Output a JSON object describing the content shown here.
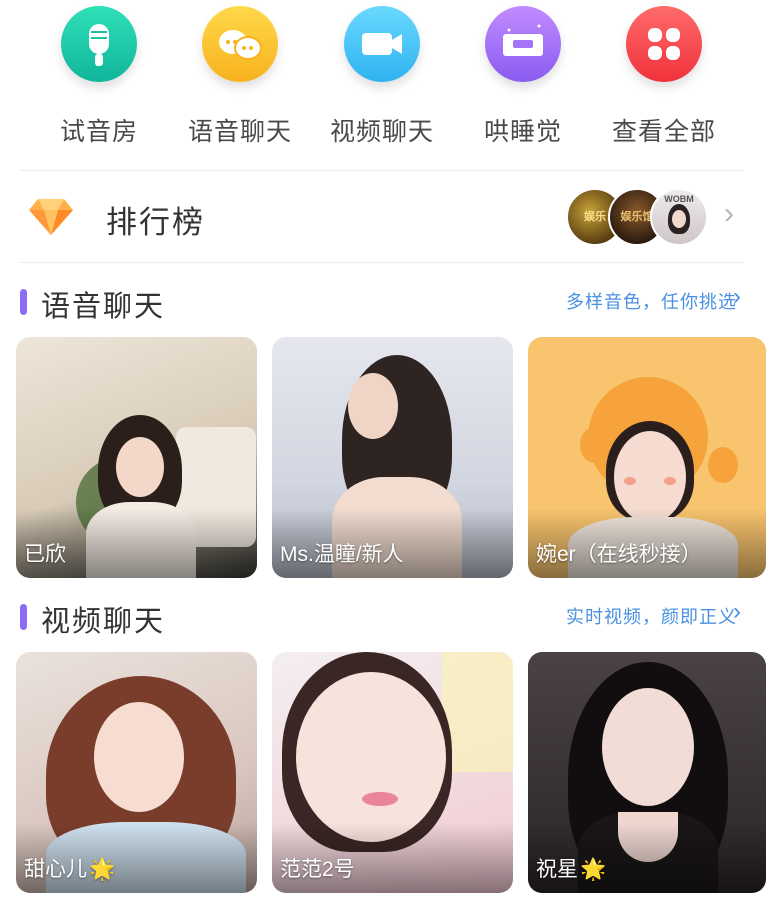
{
  "nav": {
    "items": [
      {
        "label": "试音房",
        "icon": "microphone-icon",
        "color_top": "#2fe0b8",
        "color_bottom": "#11b59a"
      },
      {
        "label": "语音聊天",
        "icon": "chat-bubbles-icon",
        "color_top": "#ffd84a",
        "color_bottom": "#f7b21d"
      },
      {
        "label": "视频聊天",
        "icon": "video-camera-icon",
        "color_top": "#6ad9ff",
        "color_bottom": "#2fb2f0"
      },
      {
        "label": "哄睡觉",
        "icon": "sleep-icon",
        "color_top": "#c18bff",
        "color_bottom": "#8a5cf0"
      },
      {
        "label": "查看全部",
        "icon": "grid-all-icon",
        "color_top": "#ff6b6b",
        "color_bottom": "#f0323c"
      }
    ]
  },
  "ranking": {
    "title": "排行榜",
    "icon": "diamond-icon",
    "avatar_texts": [
      "娱乐",
      "娱乐馆",
      "WOBM"
    ]
  },
  "voice_section": {
    "title": "语音聊天",
    "link": "多样音色，任你挑选",
    "cards": [
      {
        "name": "已欣",
        "bg": "#e9e2d6"
      },
      {
        "name": "Ms.温瞳/新人",
        "bg": "#dde0ea"
      },
      {
        "name": "婉er（在线秒接）",
        "bg": "#f8c46e"
      }
    ]
  },
  "video_section": {
    "title": "视频聊天",
    "link": "实时视频，颜即正义",
    "cards": [
      {
        "name": "甜心儿",
        "star": "🌟",
        "bg": "#e8d6d0"
      },
      {
        "name": "范范2号",
        "star": "",
        "bg": "#f7e6ea"
      },
      {
        "name": "祝星",
        "star": "🌟",
        "bg": "#3c3436"
      }
    ]
  },
  "colors": {
    "accent_bar": "#8a6df0",
    "link": "#4a90e2"
  }
}
